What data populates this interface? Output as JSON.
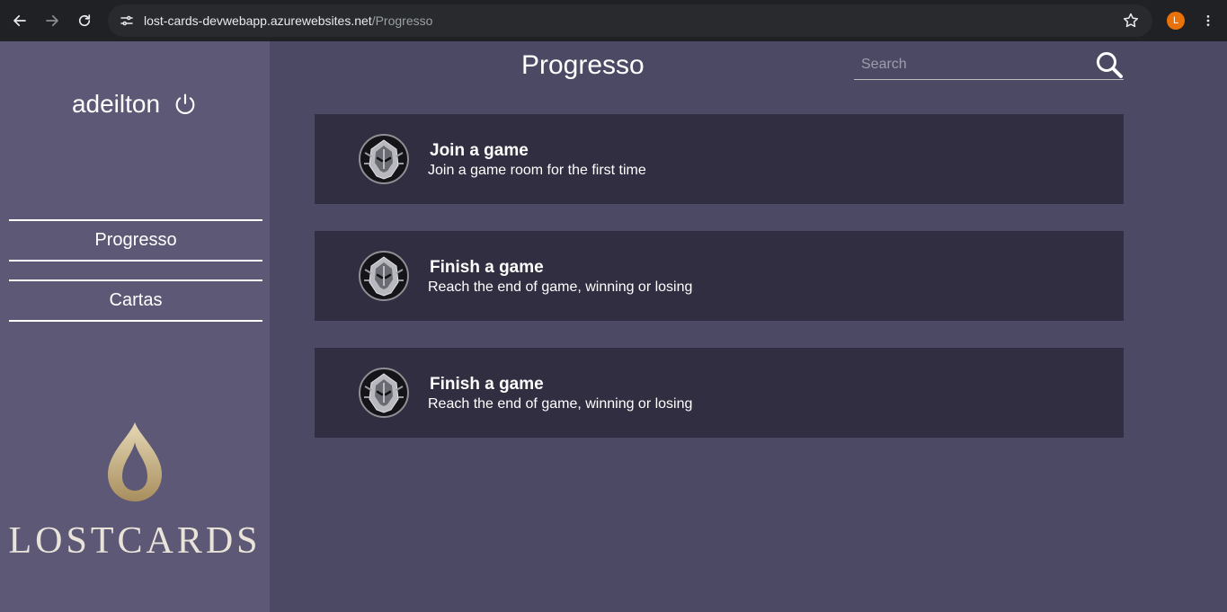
{
  "browser": {
    "url_host": "lost-cards-devwebapp.azurewebsites.net",
    "url_path": "/Progresso",
    "profile_initial": "L",
    "icons": [
      "back-icon",
      "forward-icon",
      "reload-icon",
      "site-info-icon",
      "star-icon",
      "kebab-menu-icon"
    ]
  },
  "sidebar": {
    "username": "adeilton",
    "items": [
      {
        "label": "Progresso"
      },
      {
        "label": "Cartas"
      }
    ],
    "logo_text": "LOSTCARDS"
  },
  "main": {
    "title": "Progresso",
    "search": {
      "placeholder": "Search",
      "value": ""
    },
    "achievements": [
      {
        "title": "Join a game",
        "description": "Join a game room for the first time"
      },
      {
        "title": "Finish a game",
        "description": "Reach the end of game, winning or losing"
      },
      {
        "title": "Finish a game",
        "description": "Reach the end of game, winning or losing"
      }
    ]
  },
  "colors": {
    "sidebar_bg": "#5c5875",
    "main_bg": "#4b4963",
    "card_bg": "#302e40",
    "logo_gold": "#c9b48a"
  }
}
